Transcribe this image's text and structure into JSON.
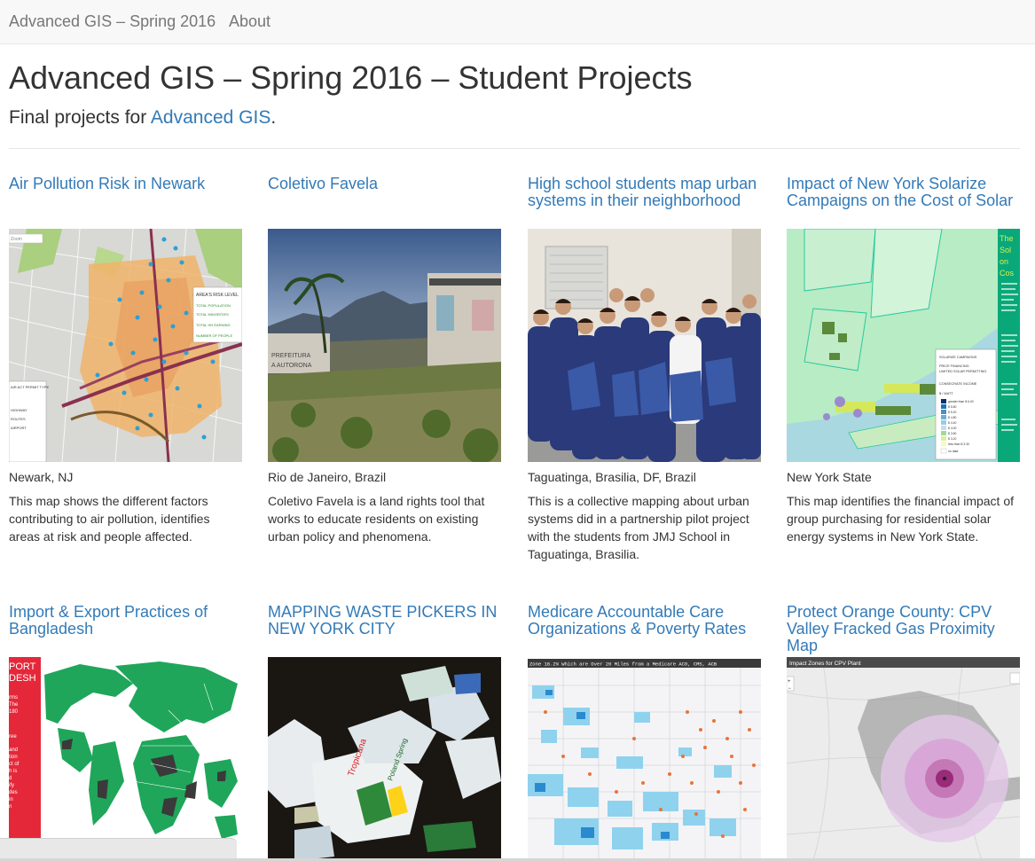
{
  "navbar": {
    "brand": "Advanced GIS – Spring 2016",
    "about": "About"
  },
  "header": {
    "title": "Advanced GIS – Spring 2016 – Student Projects",
    "subtitle_prefix": "Final projects for ",
    "subtitle_link": "Advanced GIS",
    "subtitle_suffix": "."
  },
  "projects": [
    {
      "title": "Air Pollution Risk in Newark",
      "location": "Newark, NJ",
      "description": "This map shows the different factors contributing to air pollution, identifies areas at risk and people affected.",
      "image_labels": [
        "AREA'S RISK LEVEL",
        "TOTAL POPULATION",
        "TOTAL MINORITIES",
        "TOTAL HH EARNING",
        "NUMBER OF PEOPLE",
        "AIR ACT PERMIT TYPE",
        "HIGHWAY",
        "ROUTES",
        "AIRPORT",
        "Zoom"
      ]
    },
    {
      "title": "Coletivo Favela",
      "location": "Rio de Janeiro, Brazil",
      "description": "Coletivo Favela is a land rights tool that works to educate residents on existing urban policy and phenomena.",
      "image_labels": [
        "PREFEITURA",
        "A AUTORONA"
      ]
    },
    {
      "title": "High school students map urban systems in their neighborhood",
      "location": "Taguatinga, Brasilia, DF, Brazil",
      "description": "This is a collective mapping about urban systems did in a partnership pilot project with the students from JMJ School in Taguatinga, Brasilia.",
      "image_labels": []
    },
    {
      "title": "Impact of New York Solarize Campaigns on the Cost of Solar",
      "location": "New York State",
      "description": "This map identifies the financial impact of group purchasing for residential solar energy systems in New York State.",
      "image_labels": [
        "The",
        "Sol",
        "on",
        "Cos",
        "SOLARIZE CAMPAIGNS",
        "PRICE FINANCING",
        "LIMITED SOLAR PERMITTING",
        "CONSECRATE INCOME",
        "$ / WATT",
        "greater than $ 6.00",
        "$ 5.60",
        "$ 5.20",
        "$ 4.80",
        "$ 4.40",
        "$ 4.00",
        "$ 3.60",
        "$ 3.20",
        "less than $ 3.30",
        "no data"
      ]
    },
    {
      "title": "Import & Export Practices of Bangladesh",
      "location": "",
      "description": "",
      "image_labels": [
        "PORT",
        "DESH",
        "rms",
        "The",
        "180",
        "ree",
        "and",
        "tion",
        "ct of",
        "h is",
        "d",
        "ify",
        "des",
        "in",
        "n"
      ]
    },
    {
      "title": "MAPPING WASTE PICKERS IN NEW YORK CITY",
      "location": "",
      "description": "",
      "image_labels": [
        "Tropicana",
        "Poland Spring"
      ]
    },
    {
      "title": "Medicare Accountable Care Organizations & Poverty Rates",
      "location": "",
      "description": "",
      "image_labels": [
        "Zone 18.2% Which are Over 20 Miles from a Medicare ACO, CMS, ACB"
      ]
    },
    {
      "title": "Protect Orange County: CPV Valley Fracked Gas Proximity Map",
      "location": "",
      "description": "",
      "image_labels": [
        "Impact Zones for CPV Plant",
        "+",
        "−"
      ]
    }
  ],
  "colors": {
    "link": "#337ab7",
    "navbar_bg": "#f8f8f8",
    "text": "#333333",
    "muted": "#777777"
  }
}
